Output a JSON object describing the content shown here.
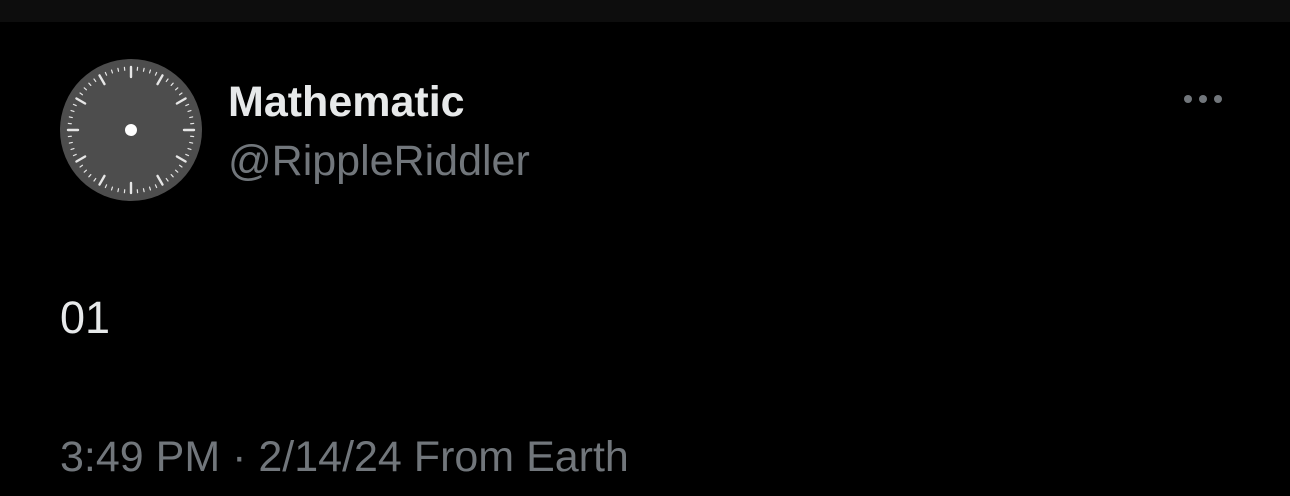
{
  "tweet": {
    "display_name": "Mathematic",
    "handle": "@RippleRiddler",
    "text": "01",
    "time": "3:49 PM",
    "separator": "·",
    "date": "2/14/24",
    "source": "From Earth"
  },
  "avatar": {
    "icon": "clock-face-icon",
    "face_color": "#4d4d4d",
    "mark_color": "#e6e6e6"
  },
  "colors": {
    "background": "#000000",
    "primary_text": "#e7e9ea",
    "secondary_text": "#71767b"
  }
}
